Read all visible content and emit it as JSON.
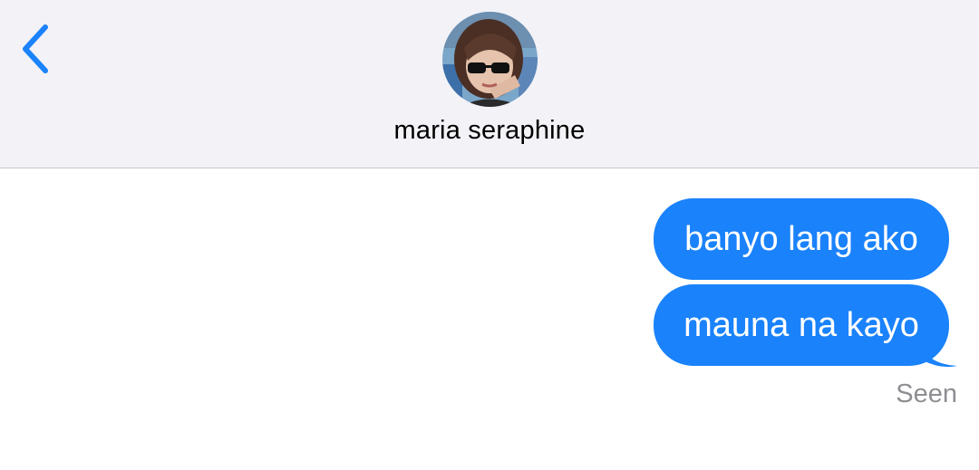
{
  "header": {
    "contact_name": "maria seraphine",
    "colors": {
      "background": "#f2f2f7",
      "accent": "#1a82fb",
      "divider": "#c6c6c8"
    },
    "back_icon": "chevron-left-icon",
    "avatar_description": "contact-avatar"
  },
  "thread": {
    "messages": [
      {
        "text": "banyo lang ako",
        "sender": "me"
      },
      {
        "text": "mauna na kayo",
        "sender": "me"
      }
    ],
    "status": "Seen",
    "bubble_color": "#1a82fb"
  }
}
